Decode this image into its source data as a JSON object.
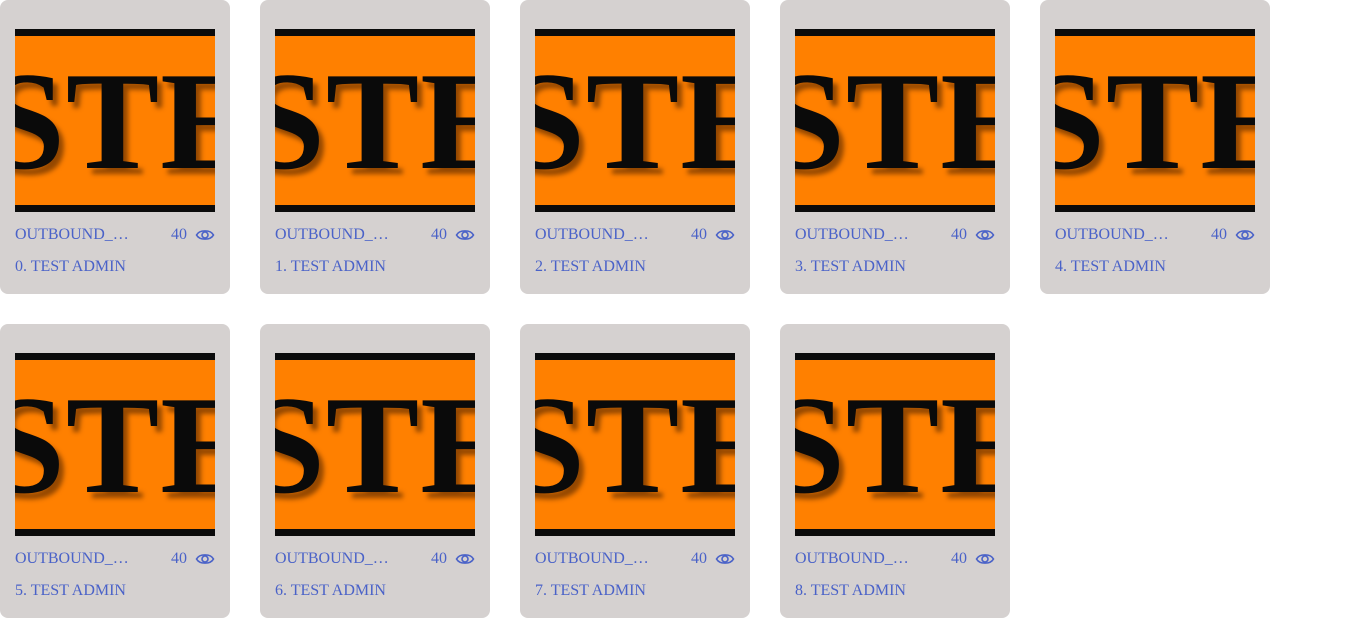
{
  "colors": {
    "card_background": "#d5d1d0",
    "thumbnail_background": "#ff8000",
    "thumbnail_band": "#0b0b0b",
    "link_text": "#4a62c8"
  },
  "cards": [
    {
      "thumbnail_text": "STE",
      "title": "OUTBOUND_…",
      "views": "40",
      "views_icon": "eye-icon",
      "author": "0. TEST ADMIN"
    },
    {
      "thumbnail_text": "STE",
      "title": "OUTBOUND_…",
      "views": "40",
      "views_icon": "eye-icon",
      "author": "1. TEST ADMIN"
    },
    {
      "thumbnail_text": "STE",
      "title": "OUTBOUND_…",
      "views": "40",
      "views_icon": "eye-icon",
      "author": "2. TEST ADMIN"
    },
    {
      "thumbnail_text": "STE",
      "title": "OUTBOUND_…",
      "views": "40",
      "views_icon": "eye-icon",
      "author": "3. TEST ADMIN"
    },
    {
      "thumbnail_text": "STE",
      "title": "OUTBOUND_…",
      "views": "40",
      "views_icon": "eye-icon",
      "author": "4. TEST ADMIN"
    },
    {
      "thumbnail_text": "STE",
      "title": "OUTBOUND_…",
      "views": "40",
      "views_icon": "eye-icon",
      "author": "5. TEST ADMIN"
    },
    {
      "thumbnail_text": "STE",
      "title": "OUTBOUND_…",
      "views": "40",
      "views_icon": "eye-icon",
      "author": "6. TEST ADMIN"
    },
    {
      "thumbnail_text": "STE",
      "title": "OUTBOUND_…",
      "views": "40",
      "views_icon": "eye-icon",
      "author": "7. TEST ADMIN"
    },
    {
      "thumbnail_text": "STE",
      "title": "OUTBOUND_…",
      "views": "40",
      "views_icon": "eye-icon",
      "author": "8. TEST ADMIN"
    }
  ]
}
